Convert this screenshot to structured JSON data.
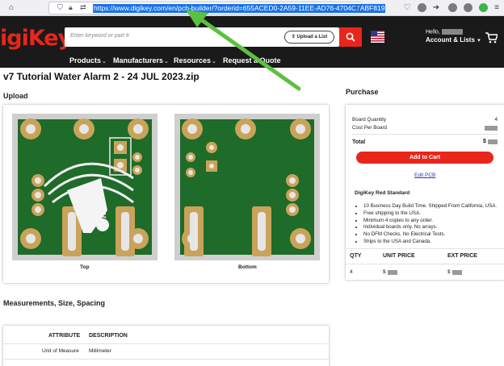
{
  "browser": {
    "url": "https://www.digikey.com/en/pcb-builder/?orderid=655ACED0-2A59-11EE-AD76-4704C7ABF819"
  },
  "header": {
    "logo_text": "igiKey",
    "search_placeholder": "Enter keyword or part #",
    "upload_list_label": "Upload a List",
    "hello_label": "Hello,",
    "account_label": "Account & Lists",
    "nav": [
      "Products",
      "Manufacturers",
      "Resources",
      "Request a Quote"
    ]
  },
  "page": {
    "title": "v7 Tutorial Water Alarm 2 - 24 JUL 2023.zip",
    "upload_heading": "Upload",
    "top_label": "Top",
    "bottom_label": "Bottom",
    "board_marking": "v7/24",
    "measurements_heading": "Measurements, Size, Spacing",
    "attr_table": {
      "headers": [
        "ATTRIBUTE",
        "DESCRIPTION"
      ],
      "rows": [
        {
          "attribute": "Unit of Measure",
          "description": "Millimeter"
        }
      ]
    }
  },
  "purchase": {
    "heading": "Purchase",
    "board_quantity_label": "Board Quantity",
    "board_quantity_value": "4",
    "cost_per_board_label": "Cost Per Board",
    "total_label": "Total",
    "add_to_cart_label": "Add to Cart",
    "edit_pcb_label": "Edit PCB",
    "service_name": "DigiKey Red Standard",
    "bullets": [
      "10 Business Day Build Time. Shipped From California, USA.",
      "Free shipping to the USA.",
      "Minimum 4 copies to any order.",
      "Individual boards only. No arrays.",
      "No DFM Checks. No Electrical Tests.",
      "Ships to the USA and Canada."
    ],
    "price_table": {
      "headers": [
        "QTY",
        "UNIT PRICE",
        "EXT PRICE"
      ],
      "qty": "4"
    }
  },
  "colors": {
    "brand_red": "#e8261c",
    "header_bg": "#1a1a1a",
    "pcb_green": "#1e6b2a",
    "pad_gold": "#c9a35a",
    "arrow_green": "#5cc140",
    "url_highlight": "#1a73e8"
  },
  "icons": [
    "home-icon",
    "shield-icon",
    "lock-icon",
    "settings-icon",
    "star-icon",
    "search-icon",
    "cart-icon",
    "flag-icon"
  ]
}
